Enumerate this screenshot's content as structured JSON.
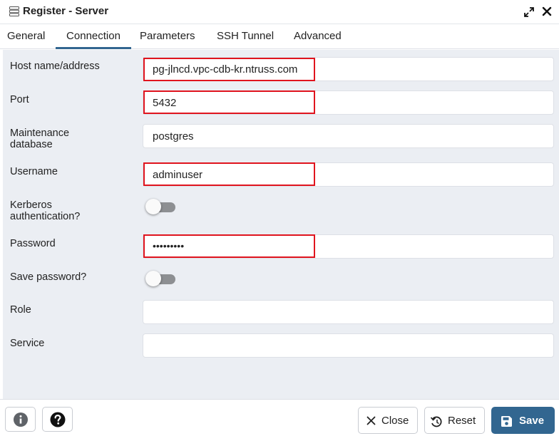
{
  "window": {
    "title": "Register - Server",
    "title_icon": "server-icon",
    "expand_icon": "expand-icon",
    "close_icon": "close-icon"
  },
  "tabs": [
    {
      "label": "General",
      "active": false
    },
    {
      "label": "Connection",
      "active": true
    },
    {
      "label": "Parameters",
      "active": false
    },
    {
      "label": "SSH Tunnel",
      "active": false
    },
    {
      "label": "Advanced",
      "active": false
    }
  ],
  "form": {
    "host": {
      "label": "Host name/address",
      "value": "pg-jlncd.vpc-cdb-kr.ntruss.com"
    },
    "port": {
      "label": "Port",
      "value": "5432"
    },
    "maintenance_db": {
      "label_line1": "Maintenance",
      "label_line2": "database",
      "value": "postgres"
    },
    "username": {
      "label": "Username",
      "value": "adminuser"
    },
    "kerberos": {
      "label_line1": "Kerberos",
      "label_line2": "authentication?",
      "enabled": false
    },
    "password": {
      "label": "Password",
      "value": "•••••••••"
    },
    "save_password": {
      "label": "Save password?",
      "enabled": false
    },
    "role": {
      "label": "Role",
      "value": ""
    },
    "service": {
      "label": "Service",
      "value": ""
    }
  },
  "footer": {
    "info_icon": "info-icon",
    "help_icon": "help-icon",
    "close_label": "Close",
    "reset_label": "Reset",
    "save_label": "Save"
  },
  "colors": {
    "accent": "#326690",
    "highlight": "#e0141e",
    "panel_bg": "#ebeef3"
  }
}
